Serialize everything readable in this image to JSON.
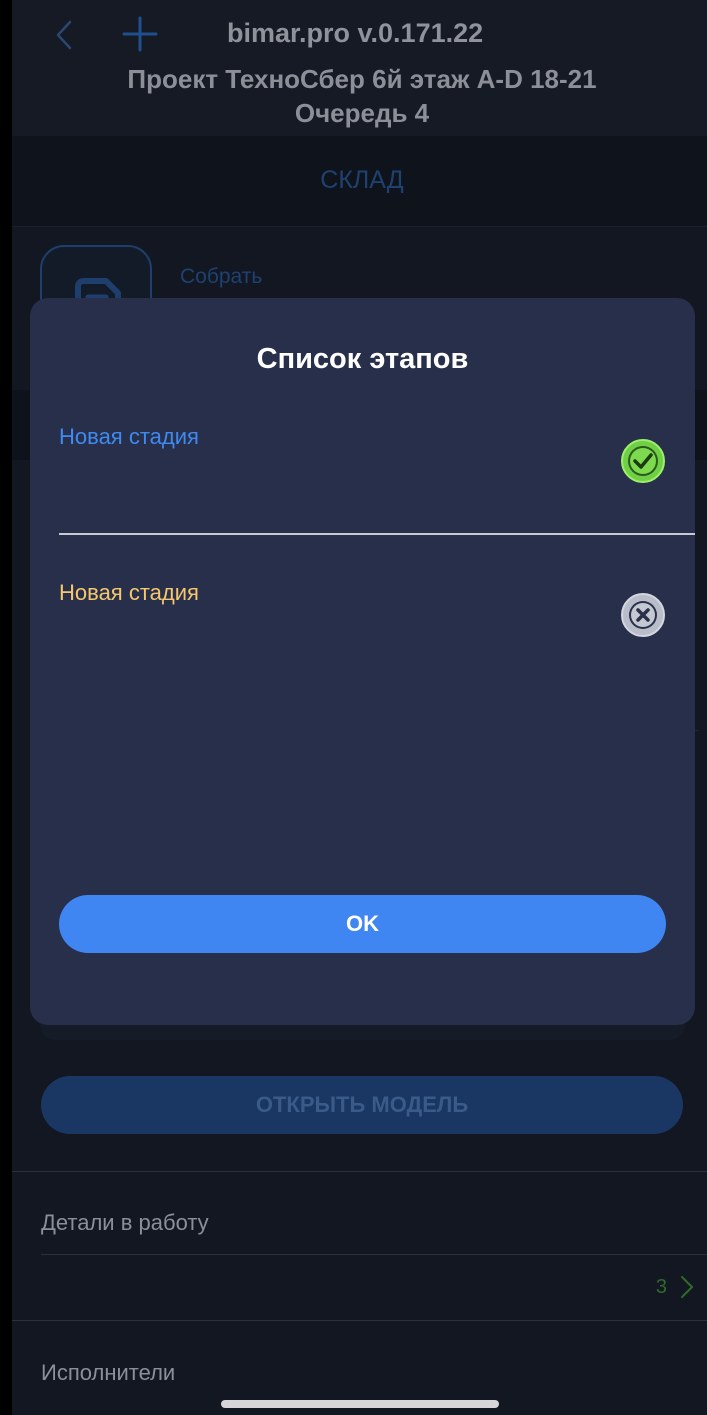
{
  "header": {
    "app_version": "bimar.pro v.0.171.22",
    "project_title_line1": "Проект ТехноСбер 6й этаж A-D 18-21",
    "project_title_line2": "Очередь 4"
  },
  "tabs": {
    "active": "СКЛАД"
  },
  "actions": {
    "assemble_label": "Собрать",
    "open_model_label": "ОТКРЫТЬ МОДЕЛЬ"
  },
  "sections": {
    "details_label": "Детали в работу",
    "details_count": "3",
    "executors_label": "Исполнители"
  },
  "modal": {
    "title": "Список этапов",
    "stages": [
      {
        "label": "Новая стадия",
        "status": "done",
        "color": "#3f8af0",
        "icon": "check-circle-icon"
      },
      {
        "label": "Новая стадия",
        "status": "pending",
        "color": "#f6c76d",
        "icon": "close-circle-icon"
      }
    ],
    "ok_label": "OK"
  },
  "colors": {
    "accent": "#3f86f2",
    "success": "#7dd94d",
    "modal_bg": "#272f4b",
    "screen_bg": "#121722"
  }
}
